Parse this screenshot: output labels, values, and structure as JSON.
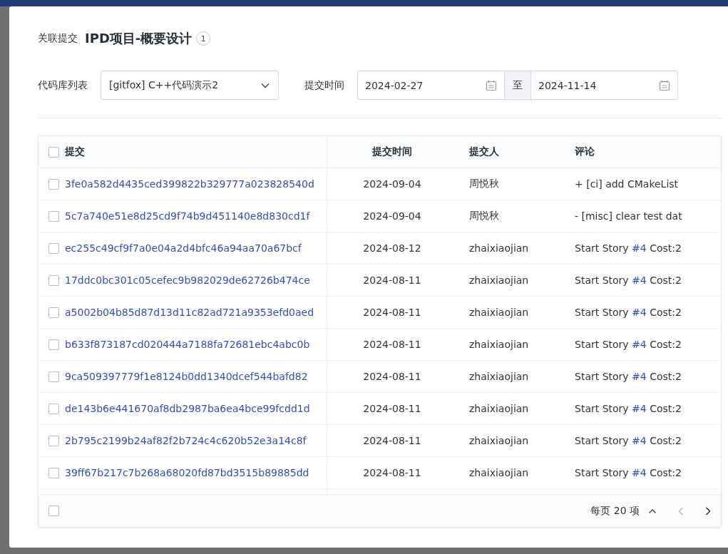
{
  "dialog": {
    "prefix": "关联提交",
    "title": "IPD项目-概要设计",
    "count": "1"
  },
  "filters": {
    "repo_label": "代码库列表",
    "repo_value": "[gitfox] C++代码演示2",
    "time_label": "提交时间",
    "date_from": "2024-02-27",
    "date_sep": "至",
    "date_to": "2024-11-14"
  },
  "table": {
    "select_all_checked": false,
    "columns": [
      "提交",
      "提交时间",
      "提交人",
      "评论"
    ],
    "rows": [
      {
        "checked": false,
        "commit": "3fe0a582d4435ced399822b329777a023828540d",
        "time": "2024-09-04",
        "author": "周悦秋",
        "comment": {
          "text": "+ [ci] add CMakeList"
        }
      },
      {
        "checked": false,
        "commit": "5c7a740e51e8d25cd9f74b9d451140e8d830cd1f",
        "time": "2024-09-04",
        "author": "周悦秋",
        "comment": {
          "text": "- [misc] clear test dat"
        }
      },
      {
        "checked": false,
        "commit": "ec255c49cf9f7a0e04a2d4bfc46a94aa70a67bcf",
        "time": "2024-08-12",
        "author": "zhaixiaojian",
        "comment": {
          "text": "Start Story ",
          "link": "#4",
          "rest": " Cost:2"
        }
      },
      {
        "checked": false,
        "commit": "17ddc0bc301c05cefec9b982029de62726b474ce",
        "time": "2024-08-11",
        "author": "zhaixiaojian",
        "comment": {
          "text": "Start Story ",
          "link": "#4",
          "rest": " Cost:2"
        }
      },
      {
        "checked": false,
        "commit": "a5002b04b85d87d13d11c82ad721a9353efd0aed",
        "time": "2024-08-11",
        "author": "zhaixiaojian",
        "comment": {
          "text": "Start Story ",
          "link": "#4",
          "rest": " Cost:2"
        }
      },
      {
        "checked": false,
        "commit": "b633f873187cd020444a7188fa72681ebc4abc0b",
        "time": "2024-08-11",
        "author": "zhaixiaojian",
        "comment": {
          "text": "Start Story ",
          "link": "#4",
          "rest": " Cost:2"
        }
      },
      {
        "checked": false,
        "commit": "9ca509397779f1e8124b0dd1340dcef544bafd82",
        "time": "2024-08-11",
        "author": "zhaixiaojian",
        "comment": {
          "text": "Start Story ",
          "link": "#4",
          "rest": " Cost:2"
        }
      },
      {
        "checked": false,
        "commit": "de143b6e441670af8db2987ba6ea4bce99fcdd1d",
        "time": "2024-08-11",
        "author": "zhaixiaojian",
        "comment": {
          "text": "Start Story ",
          "link": "#4",
          "rest": " Cost:2"
        }
      },
      {
        "checked": false,
        "commit": "2b795c2199b24af82f2b724c4c620b52e3a14c8f",
        "time": "2024-08-11",
        "author": "zhaixiaojian",
        "comment": {
          "text": "Start Story ",
          "link": "#4",
          "rest": " Cost:2"
        }
      },
      {
        "checked": false,
        "commit": "39ff67b217c7b268a68020fd87bd3515b89885dd",
        "time": "2024-08-11",
        "author": "zhaixiaojian",
        "comment": {
          "text": "Start Story ",
          "link": "#4",
          "rest": " Cost:2"
        }
      }
    ]
  },
  "footer": {
    "select_checked": false,
    "page_size": "每页 20 项",
    "prev_disabled": true,
    "next_disabled": false
  }
}
